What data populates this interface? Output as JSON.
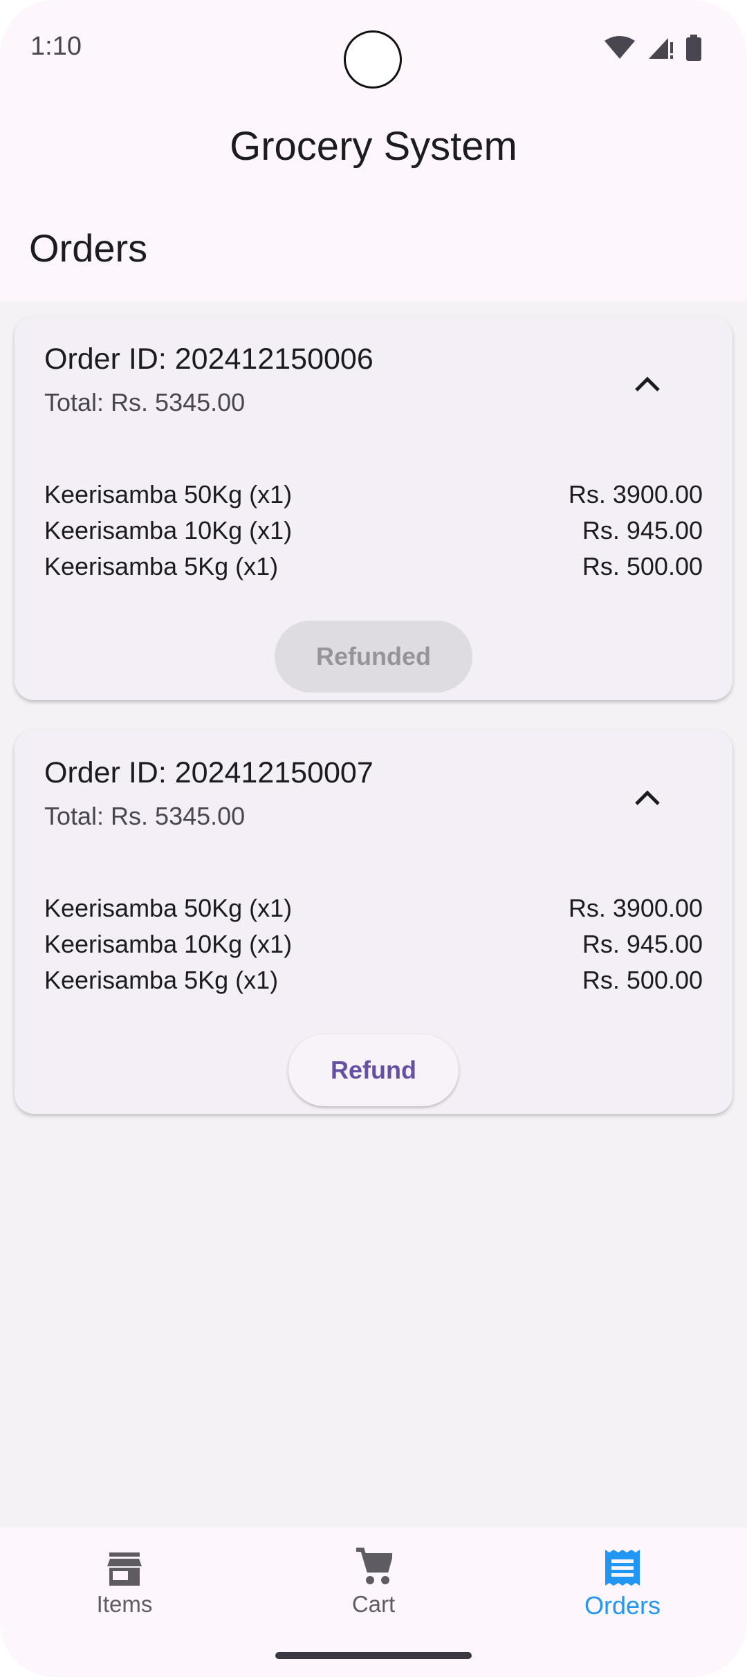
{
  "status_bar": {
    "time": "1:10"
  },
  "app_bar": {
    "title": "Grocery System"
  },
  "page": {
    "title": "Orders"
  },
  "orders": [
    {
      "id_label": "Order ID: 202412150006",
      "total_label": "Total: Rs. 5345.00",
      "items": [
        {
          "name": "Keerisamba 50Kg (x1)",
          "price": "Rs. 3900.00"
        },
        {
          "name": "Keerisamba 10Kg (x1)",
          "price": "Rs. 945.00"
        },
        {
          "name": "Keerisamba 5Kg (x1)",
          "price": "Rs. 500.00"
        }
      ],
      "action_label": "Refunded",
      "action_enabled": false
    },
    {
      "id_label": "Order ID: 202412150007",
      "total_label": "Total: Rs. 5345.00",
      "items": [
        {
          "name": "Keerisamba 50Kg (x1)",
          "price": "Rs. 3900.00"
        },
        {
          "name": "Keerisamba 10Kg (x1)",
          "price": "Rs. 945.00"
        },
        {
          "name": "Keerisamba 5Kg (x1)",
          "price": "Rs. 500.00"
        }
      ],
      "action_label": "Refund",
      "action_enabled": true
    }
  ],
  "bottom_nav": {
    "items": [
      {
        "label": "Items",
        "icon": "store-icon",
        "active": false
      },
      {
        "label": "Cart",
        "icon": "cart-icon",
        "active": false
      },
      {
        "label": "Orders",
        "icon": "receipt-icon",
        "active": true
      }
    ]
  },
  "colors": {
    "accent": "#2196f3",
    "refund_button_text": "#6550a4",
    "background": "#f4f2f5",
    "card": "#f4eff6"
  }
}
